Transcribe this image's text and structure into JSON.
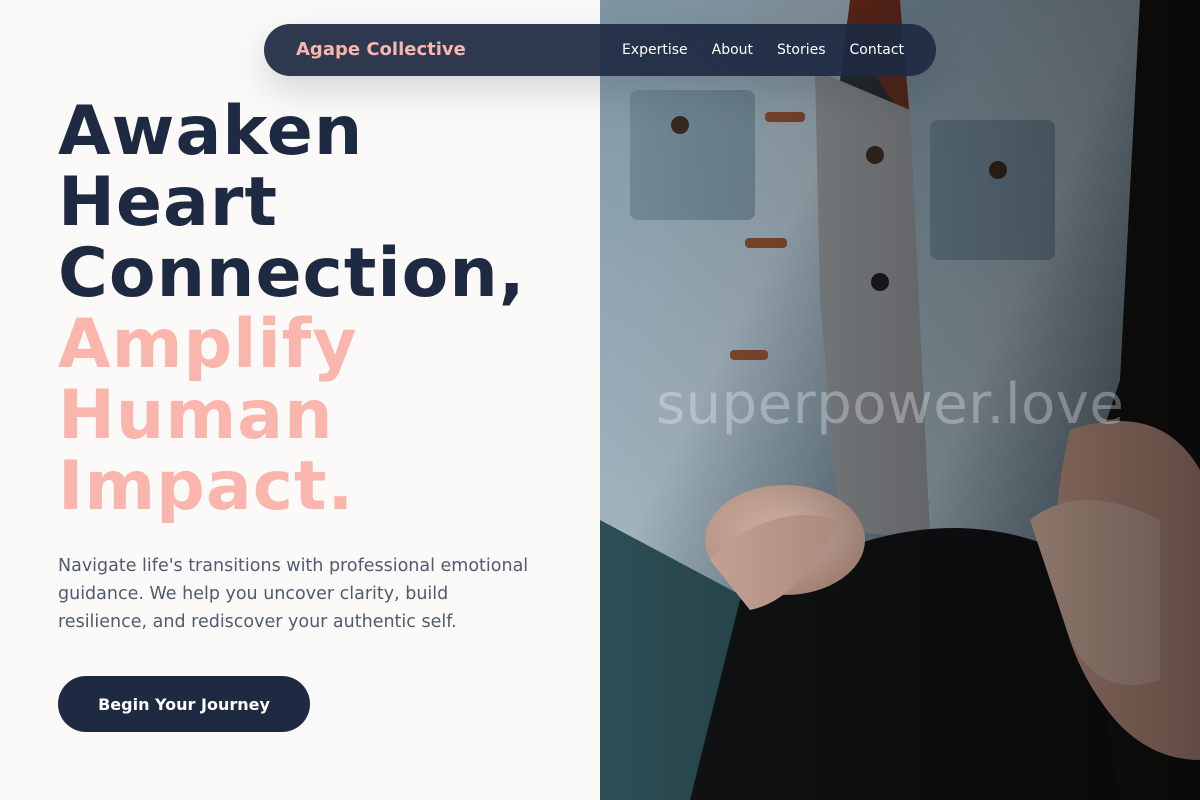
{
  "nav": {
    "brand": "Agape Collective",
    "links": [
      "Expertise",
      "About",
      "Stories",
      "Contact"
    ]
  },
  "hero": {
    "headline_dark": [
      "Awaken",
      "Heart",
      "Connection,"
    ],
    "headline_accent": [
      "Amplify",
      "Human",
      "Impact."
    ],
    "description": "Navigate life's transitions with professional emotional guidance. We help you uncover clarity, build resilience, and rediscover your authentic self.",
    "cta_label": "Begin Your Journey",
    "image_watermark": "superpower.love"
  },
  "colors": {
    "navy": "#1e2a42",
    "accent_pink": "#fab5ac",
    "body_text": "#4f5b6e",
    "background": "#fcfaf9"
  }
}
